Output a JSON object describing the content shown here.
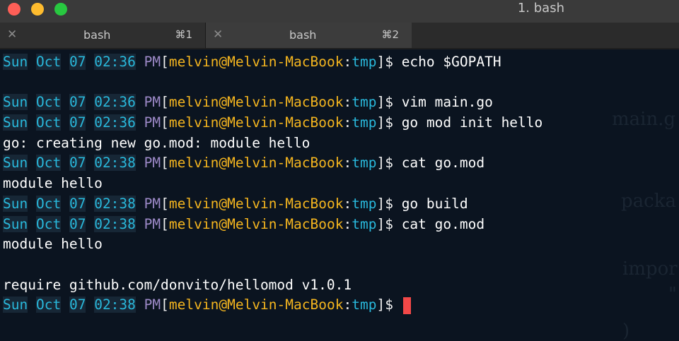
{
  "window": {
    "title": "1. bash"
  },
  "tabs": [
    {
      "label": "bash",
      "shortcut": "⌘1",
      "close": "✕"
    },
    {
      "label": "bash",
      "shortcut": "⌘2",
      "close": "✕"
    }
  ],
  "background_code": [
    "main.g",
    "packa",
    "impor",
    "\"",
    ")"
  ],
  "prompt": {
    "day": "Sun",
    "month": "Oct",
    "date": "07",
    "user": "melvin",
    "host": "Melvin-MacBook",
    "dir": "tmp",
    "ampm": "PM"
  },
  "lines": [
    {
      "time": "02:36",
      "cmd": "echo $GOPATH"
    },
    {
      "text": ""
    },
    {
      "time": "02:36",
      "cmd": "vim main.go"
    },
    {
      "time": "02:36",
      "cmd": "go mod init hello"
    },
    {
      "text": "go: creating new go.mod: module hello"
    },
    {
      "time": "02:38",
      "cmd": "cat go.mod"
    },
    {
      "text": "module hello"
    },
    {
      "time": "02:38",
      "cmd": "go build"
    },
    {
      "time": "02:38",
      "cmd": "cat go.mod"
    },
    {
      "text": "module hello"
    },
    {
      "text": ""
    },
    {
      "text": "require github.com/donvito/hellomod v1.0.1"
    },
    {
      "time": "02:38",
      "cmd": "",
      "cursor": true
    }
  ],
  "colors": {
    "background": "#0b1420",
    "prompt_cyan": "#29b8db",
    "prompt_user": "#f4b51f",
    "prompt_ampm": "#9d8ac8",
    "cursor": "#f24848"
  }
}
